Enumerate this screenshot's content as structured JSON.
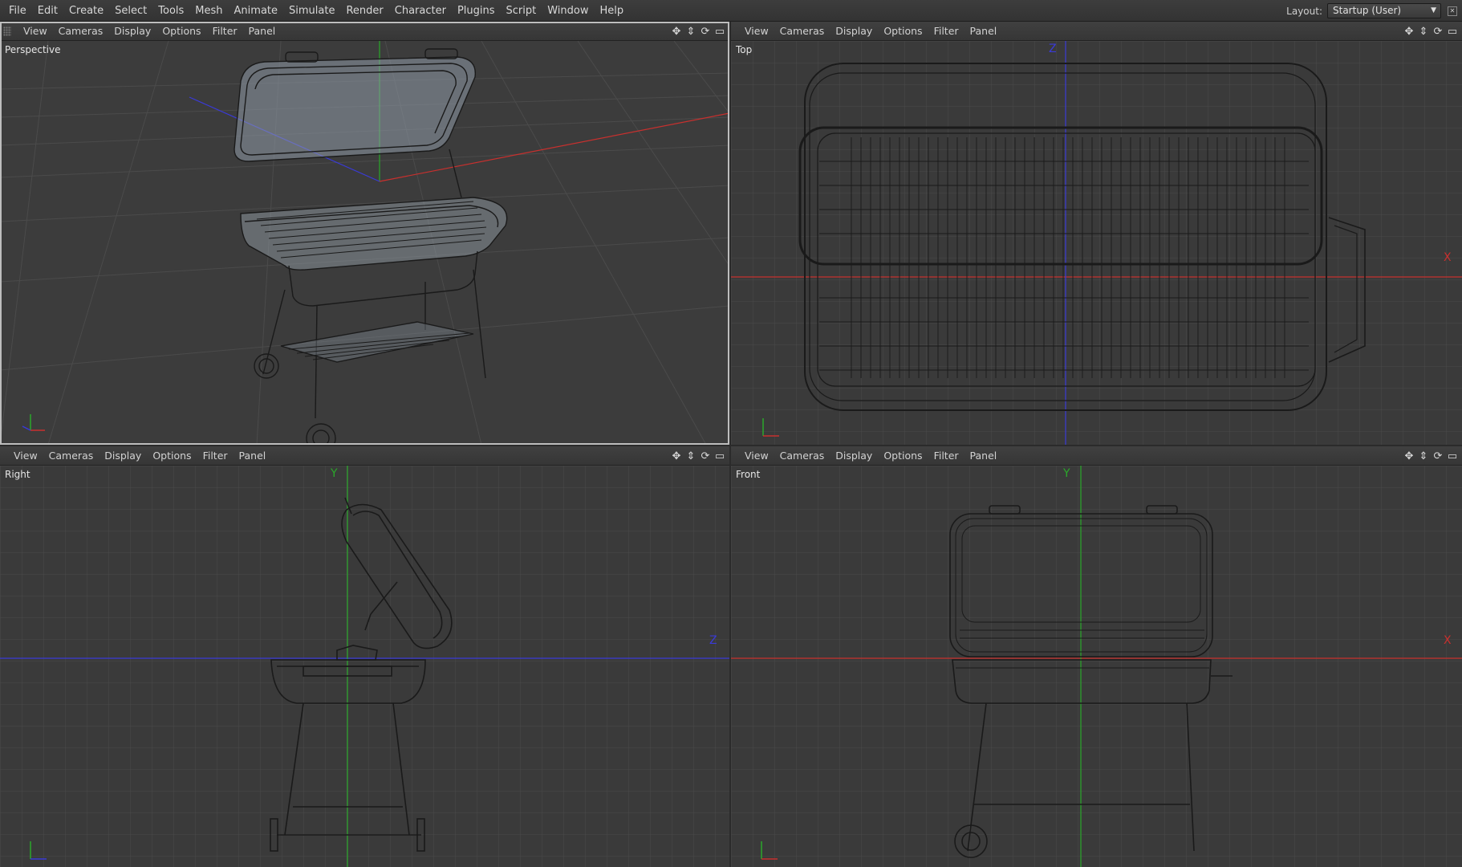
{
  "menubar": {
    "items": [
      "File",
      "Edit",
      "Create",
      "Select",
      "Tools",
      "Mesh",
      "Animate",
      "Simulate",
      "Render",
      "Character",
      "Plugins",
      "Script",
      "Window",
      "Help"
    ],
    "layout_label": "Layout:",
    "layout_value": "Startup (User)"
  },
  "viewport_menu": [
    "View",
    "Cameras",
    "Display",
    "Options",
    "Filter",
    "Panel"
  ],
  "viewports": {
    "perspective": {
      "name": "Perspective"
    },
    "top": {
      "name": "Top",
      "axis_v": "Z",
      "axis_h": "X"
    },
    "right": {
      "name": "Right",
      "axis_v": "Y",
      "axis_h": "Z"
    },
    "front": {
      "name": "Front",
      "axis_v": "Y",
      "axis_h": "X"
    }
  },
  "colors": {
    "viewport_bg": "#3a3a3a",
    "grid": "#4a4a4a",
    "x_axis": "#c8302e",
    "y_axis": "#2aa82a",
    "z_axis": "#3a3ad8",
    "wire": "#1a1a1a"
  },
  "icons": [
    "move-view-icon",
    "zoom-view-icon",
    "rotate-view-icon",
    "toggle-panel-icon"
  ]
}
